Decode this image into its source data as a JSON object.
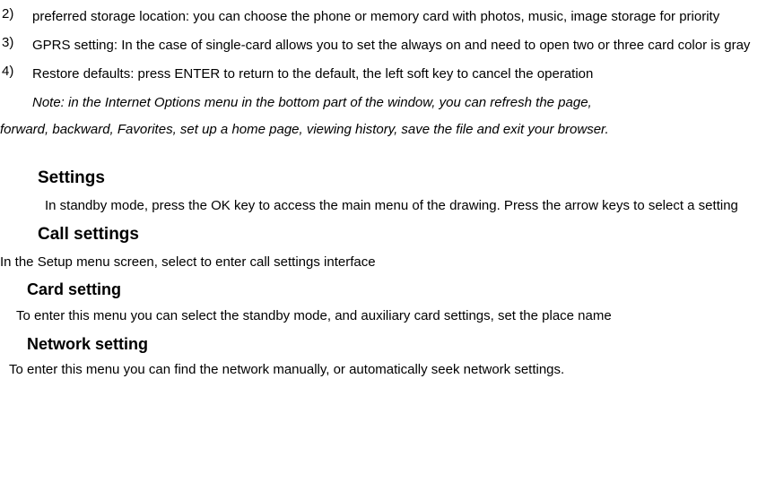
{
  "items": [
    {
      "num": "2)",
      "text": "preferred storage location: you can choose the phone or memory card with photos, music, image storage for priority"
    },
    {
      "num": "3)",
      "text": "GPRS setting: In the case of single-card allows you to set the always on and need to open two or three card color is gray"
    },
    {
      "num": "4)",
      "text": "Restore defaults: press ENTER to return to the default, the left soft key to cancel the operation"
    }
  ],
  "note_line1": "Note: in the Internet Options menu in the bottom part of the window, you can refresh the page,",
  "note_line2": "forward, backward, Favorites, set up a home page, viewing history, save the file and exit your browser.",
  "settings": {
    "heading": "Settings",
    "text": "In standby mode, press the OK key to access the main menu of the drawing. Press the arrow keys to select a setting"
  },
  "call": {
    "heading": "Call settings",
    "text": "In the Setup menu screen, select to enter call settings interface"
  },
  "card": {
    "heading": "Card setting",
    "text": "To enter this menu you can select the standby mode, and auxiliary card settings, set the place name"
  },
  "network": {
    "heading": "Network setting",
    "text": "To enter this menu you can find the network manually, or automatically seek network settings."
  }
}
